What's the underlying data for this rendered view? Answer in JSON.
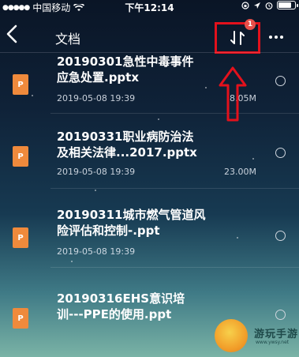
{
  "status_bar": {
    "carrier": "中国移动",
    "time": "下午12:14",
    "battery_level": 0.85
  },
  "nav": {
    "title": "文档",
    "sort_badge": "1",
    "icons": {
      "back": "chevron-left-icon",
      "sort": "sort-arrows-icon",
      "more": "more-dots-icon"
    }
  },
  "files": [
    {
      "name_line1": "20190301急性中毒事件",
      "name_line2": "应急处置.pptx",
      "date": "2019-05-08 19:39",
      "size": "8.05M",
      "icon_label": "P"
    },
    {
      "name_line1": "20190331职业病防治法",
      "name_line2": "及相关法律...2017.pptx",
      "date": "2019-05-08 19:39",
      "size": "23.00M",
      "icon_label": "P"
    },
    {
      "name_line1": "20190311城市燃气管道风",
      "name_line2": "险评估和控制-.ppt",
      "date": "2019-05-08 19:39",
      "size": "",
      "icon_label": "P"
    },
    {
      "name_line1": "20190316EHS意识培",
      "name_line2": "训---PPE的使用.ppt",
      "date": "",
      "size": "",
      "icon_label": "P"
    }
  ],
  "watermark": {
    "text": "游玩手游",
    "sub": "www.ywsy.net"
  },
  "colors": {
    "highlight": "#e3111c",
    "file_icon": "#ef8a3c",
    "badge": "#e8504a"
  }
}
